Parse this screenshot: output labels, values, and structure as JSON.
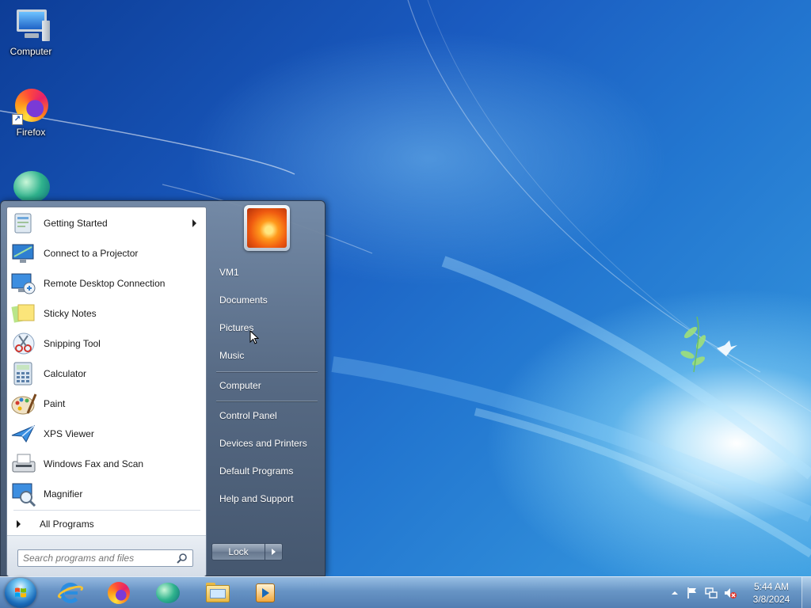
{
  "desktop": {
    "icons": [
      {
        "label": "Computer",
        "icon": "computer-icon"
      },
      {
        "label": "Firefox",
        "icon": "firefox-icon"
      },
      {
        "label": "",
        "icon": "bubble-app-icon"
      }
    ]
  },
  "start_menu": {
    "programs": [
      {
        "label": "Getting Started",
        "icon": "getting-started-icon",
        "has_submenu": true
      },
      {
        "label": "Connect to a Projector",
        "icon": "projector-icon"
      },
      {
        "label": "Remote Desktop Connection",
        "icon": "remote-desktop-icon"
      },
      {
        "label": "Sticky Notes",
        "icon": "sticky-notes-icon"
      },
      {
        "label": "Snipping Tool",
        "icon": "snipping-tool-icon"
      },
      {
        "label": "Calculator",
        "icon": "calculator-icon"
      },
      {
        "label": "Paint",
        "icon": "paint-icon"
      },
      {
        "label": "XPS Viewer",
        "icon": "xps-viewer-icon"
      },
      {
        "label": "Windows Fax and Scan",
        "icon": "fax-scan-icon"
      },
      {
        "label": "Magnifier",
        "icon": "magnifier-icon"
      }
    ],
    "all_programs_label": "All Programs",
    "search_placeholder": "Search programs and files",
    "right_items": {
      "user": "VM1",
      "documents": "Documents",
      "pictures": "Pictures",
      "music": "Music",
      "computer": "Computer",
      "control_panel": "Control Panel",
      "devices_printers": "Devices and Printers",
      "default_programs": "Default Programs",
      "help_support": "Help and Support"
    },
    "lock_label": "Lock"
  },
  "taskbar": {
    "pinned": [
      "internet-explorer-icon",
      "firefox-icon",
      "bubble-app-icon",
      "windows-explorer-icon",
      "media-player-icon"
    ],
    "clock_time": "5:44 AM",
    "clock_date": "3/8/2024"
  },
  "colors": {
    "wallpaper_dark": "#0d3d97",
    "wallpaper_light": "#3aa0e2",
    "menu_text": "#1a1a1a"
  }
}
